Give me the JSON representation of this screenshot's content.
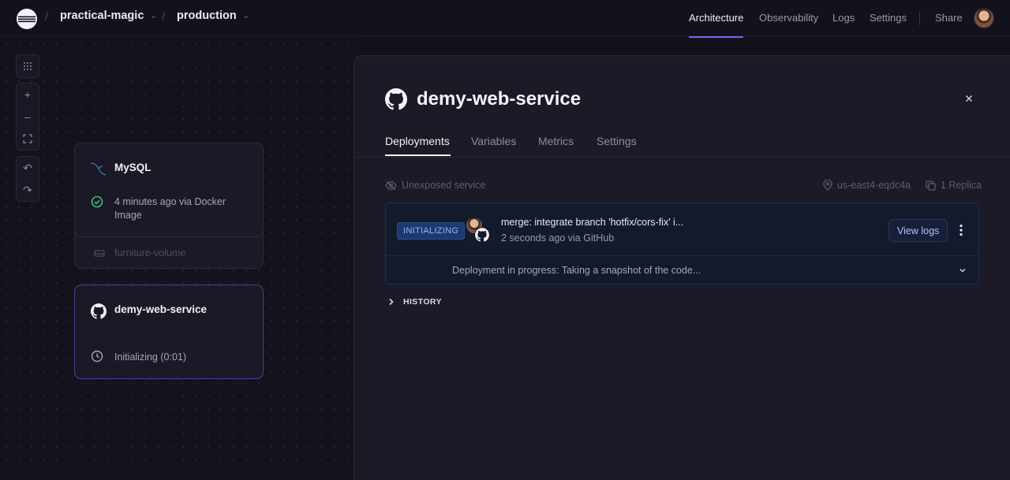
{
  "header": {
    "project": "practical-magic",
    "environment": "production",
    "nav": [
      "Architecture",
      "Observability",
      "Logs",
      "Settings"
    ],
    "active_nav": "Architecture",
    "share_label": "Share"
  },
  "canvas": {
    "services": [
      {
        "name": "MySQL",
        "status": "4 minutes ago via Docker Image",
        "status_line1": "4 minutes ago via Docker",
        "status_line2": "Image",
        "volume": "furniture-volume"
      },
      {
        "name": "demy-web-service",
        "status": "Initializing (0:01)"
      }
    ]
  },
  "panel": {
    "title": "demy-web-service",
    "tabs": [
      "Deployments",
      "Variables",
      "Metrics",
      "Settings"
    ],
    "active_tab": "Deployments",
    "exposure": "Unexposed service",
    "region": "us-east4-eqdc4a",
    "replicas": "1 Replica",
    "deployment": {
      "status": "INITIALIZING",
      "commit_message": "merge: integrate branch 'hotfix/cors-fix' i...",
      "meta": "2 seconds ago via GitHub",
      "view_logs_label": "View logs",
      "progress": "Deployment in progress:  Taking a snapshot of the code..."
    },
    "history_label": "HISTORY"
  },
  "colors": {
    "accent": "#8b5cf6",
    "success": "#3fbf7f",
    "initializing_badge": "#1d3a6e"
  }
}
